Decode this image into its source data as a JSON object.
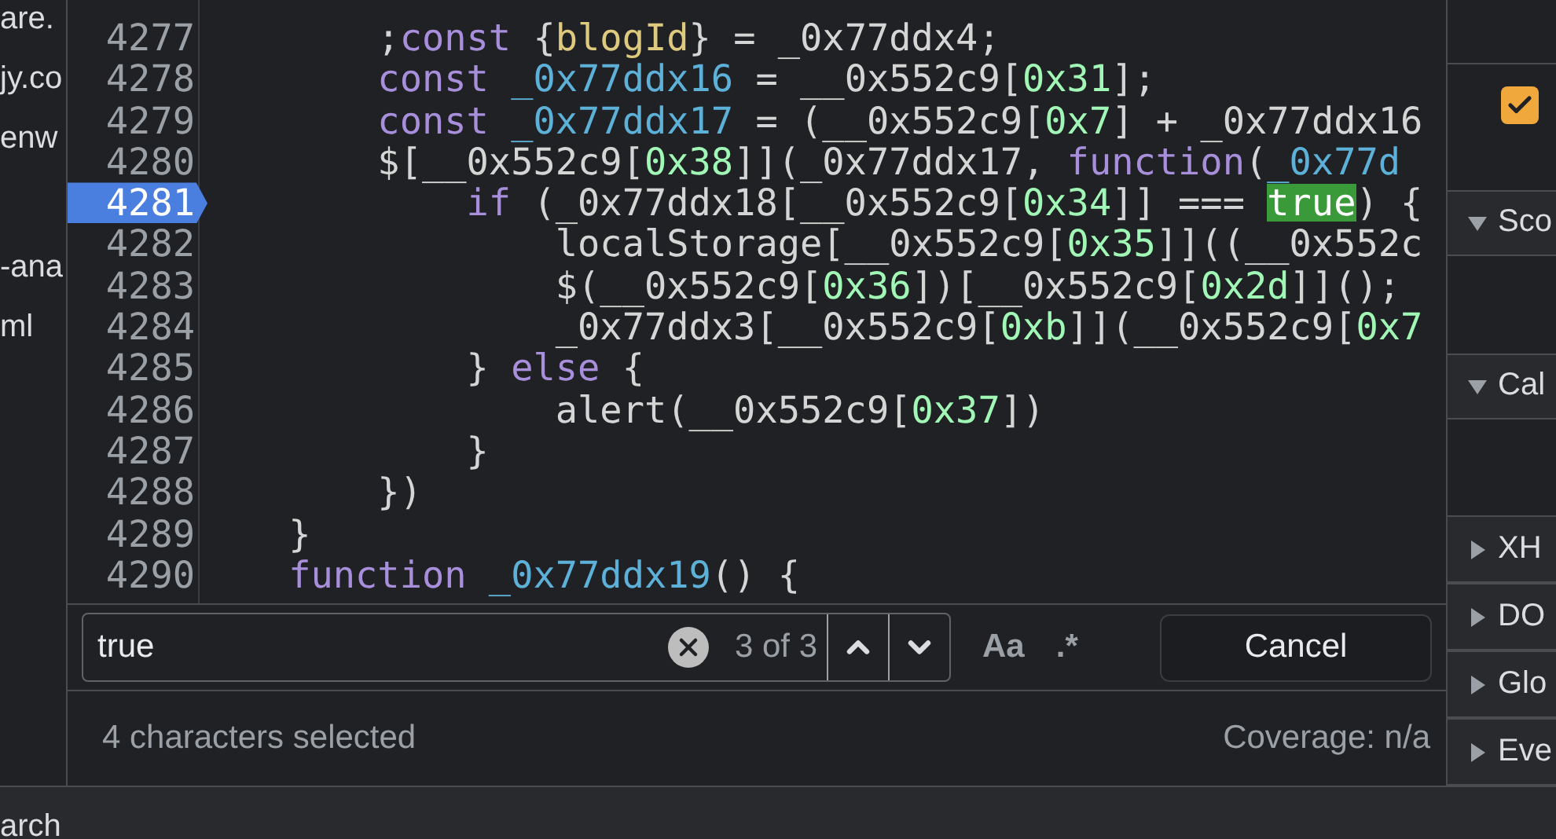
{
  "sidebar": {
    "items": [
      {
        "label": "are."
      },
      {
        "label": "jy.co"
      },
      {
        "label": "enw"
      },
      {
        "label": "-ana"
      },
      {
        "label": "ml"
      }
    ],
    "footer": "arch"
  },
  "editor": {
    "lines": [
      {
        "number": "4277",
        "breakpoint": false,
        "tokens": [
          {
            "text": "        ;",
            "kind": "plain"
          },
          {
            "text": "const",
            "kind": "keyword"
          },
          {
            "text": " {",
            "kind": "plain"
          },
          {
            "text": "blogId",
            "kind": "string"
          },
          {
            "text": "} = _0x77ddx4;",
            "kind": "plain"
          }
        ]
      },
      {
        "number": "4278",
        "breakpoint": false,
        "tokens": [
          {
            "text": "        const",
            "kind": "keyword"
          },
          {
            "text": " _0x77ddx16",
            "kind": "def"
          },
          {
            "text": " = __0x552c9[",
            "kind": "plain"
          },
          {
            "text": "0x31",
            "kind": "number"
          },
          {
            "text": "];",
            "kind": "plain"
          }
        ]
      },
      {
        "number": "4279",
        "breakpoint": false,
        "tokens": [
          {
            "text": "        const",
            "kind": "keyword"
          },
          {
            "text": " _0x77ddx17",
            "kind": "def"
          },
          {
            "text": " = (__0x552c9[",
            "kind": "plain"
          },
          {
            "text": "0x7",
            "kind": "number"
          },
          {
            "text": "] + _0x77ddx16",
            "kind": "plain"
          }
        ]
      },
      {
        "number": "4280",
        "breakpoint": false,
        "tokens": [
          {
            "text": "        $[__0x552c9[",
            "kind": "plain"
          },
          {
            "text": "0x38",
            "kind": "number"
          },
          {
            "text": "]](_0x77ddx17, ",
            "kind": "plain"
          },
          {
            "text": "function",
            "kind": "keyword"
          },
          {
            "text": "(",
            "kind": "plain"
          },
          {
            "text": "_0x77d",
            "kind": "def"
          }
        ]
      },
      {
        "number": "4281",
        "breakpoint": true,
        "tokens": [
          {
            "text": "            if",
            "kind": "keyword"
          },
          {
            "text": " (_0x77ddx18[__0x552c9[",
            "kind": "plain"
          },
          {
            "text": "0x34",
            "kind": "number"
          },
          {
            "text": "]] === ",
            "kind": "plain"
          },
          {
            "text": "true",
            "kind": "match"
          },
          {
            "text": ") {",
            "kind": "plain"
          }
        ]
      },
      {
        "number": "4282",
        "breakpoint": false,
        "tokens": [
          {
            "text": "                localStorage[__0x552c9[",
            "kind": "plain"
          },
          {
            "text": "0x35",
            "kind": "number"
          },
          {
            "text": "]]((__0x552c",
            "kind": "plain"
          }
        ]
      },
      {
        "number": "4283",
        "breakpoint": false,
        "tokens": [
          {
            "text": "                $(__0x552c9[",
            "kind": "plain"
          },
          {
            "text": "0x36",
            "kind": "number"
          },
          {
            "text": "])[__0x552c9[",
            "kind": "plain"
          },
          {
            "text": "0x2d",
            "kind": "number"
          },
          {
            "text": "]]();",
            "kind": "plain"
          }
        ]
      },
      {
        "number": "4284",
        "breakpoint": false,
        "tokens": [
          {
            "text": "                _0x77ddx3[__0x552c9[",
            "kind": "plain"
          },
          {
            "text": "0xb",
            "kind": "number"
          },
          {
            "text": "]](__0x552c9[",
            "kind": "plain"
          },
          {
            "text": "0x7",
            "kind": "number"
          }
        ]
      },
      {
        "number": "4285",
        "breakpoint": false,
        "tokens": [
          {
            "text": "            } ",
            "kind": "plain"
          },
          {
            "text": "else",
            "kind": "keyword"
          },
          {
            "text": " {",
            "kind": "plain"
          }
        ]
      },
      {
        "number": "4286",
        "breakpoint": false,
        "tokens": [
          {
            "text": "                alert(__0x552c9[",
            "kind": "plain"
          },
          {
            "text": "0x37",
            "kind": "number"
          },
          {
            "text": "])",
            "kind": "plain"
          }
        ]
      },
      {
        "number": "4287",
        "breakpoint": false,
        "tokens": [
          {
            "text": "            }",
            "kind": "plain"
          }
        ]
      },
      {
        "number": "4288",
        "breakpoint": false,
        "tokens": [
          {
            "text": "        })",
            "kind": "plain"
          }
        ]
      },
      {
        "number": "4289",
        "breakpoint": false,
        "tokens": [
          {
            "text": "    }",
            "kind": "plain"
          }
        ]
      },
      {
        "number": "4290",
        "breakpoint": false,
        "tokens": [
          {
            "text": "    function",
            "kind": "keyword"
          },
          {
            "text": " _0x77ddx19",
            "kind": "def"
          },
          {
            "text": "() {",
            "kind": "plain"
          }
        ]
      }
    ]
  },
  "search": {
    "value": "true",
    "match_count": "3 of 3",
    "match_case_label": "Aa",
    "regex_label": ".*",
    "cancel_label": "Cancel"
  },
  "status_bar": {
    "selection": "4 characters selected",
    "coverage": "Coverage: n/a"
  },
  "right_panel": {
    "checkbox": {
      "checked": true
    },
    "sections": [
      {
        "label": "Sco",
        "expanded": true
      },
      {
        "label": "Cal",
        "expanded": true
      },
      {
        "label": "XH",
        "expanded": false
      },
      {
        "label": "DO",
        "expanded": false
      },
      {
        "label": "Glo",
        "expanded": false
      },
      {
        "label": "Eve",
        "expanded": false
      }
    ]
  }
}
